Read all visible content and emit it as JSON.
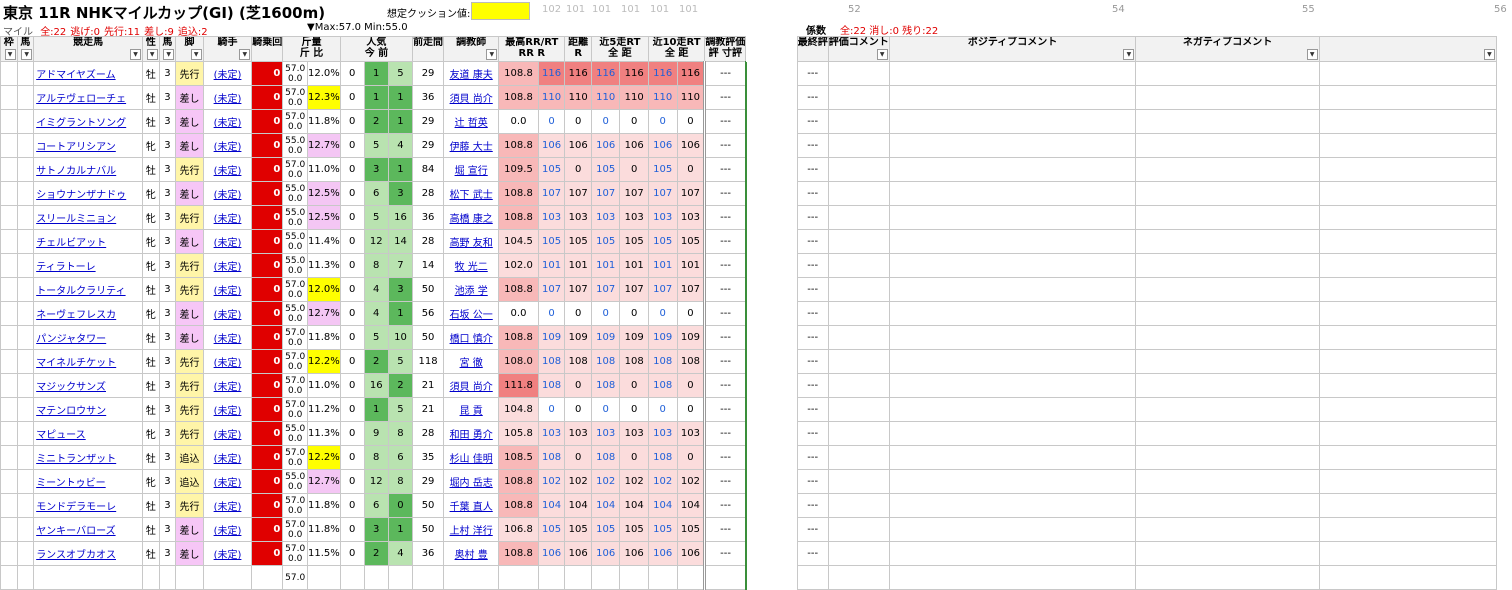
{
  "header": {
    "title": "東京 11R NHKマイルカップ(GI) (芝1600m)",
    "distance_type": "マイル",
    "counts": [
      {
        "text": "全:22",
        "color": "#e00000"
      },
      {
        "text": "逃げ:0",
        "color": "#e00000"
      },
      {
        "text": "先行:11",
        "color": "#e00000"
      },
      {
        "text": "差し:9",
        "color": "#e00000"
      },
      {
        "text": "追込:2",
        "color": "#e00000"
      }
    ],
    "cushion_label": "想定クッション値:",
    "cushion_value": "",
    "maxmin": "▼Max:57.0  Min:55.0",
    "keisu": "係数",
    "summary": "全:22  消し:0  残り:22",
    "col_numbers": [
      "102",
      "101",
      "101",
      "101",
      "101",
      "101"
    ],
    "right_numbers": [
      "52",
      "54",
      "55",
      "56"
    ]
  },
  "columns": {
    "waku": "枠",
    "uma": "馬",
    "name": "競走馬",
    "sex": "性",
    "age": "馬",
    "style": "脚",
    "jockey": "騎手",
    "kiyo": "騎乗回",
    "kinryo": "斤量",
    "kinryo_sub1": "斤",
    "kinryo_sub2": "比",
    "pop": "人気",
    "pop_sub1": "今",
    "pop_sub2": "前",
    "zensou": "前走間",
    "trainer": "調教師",
    "maxrr": "最高RR/RT",
    "maxrr_sub1": "RR",
    "maxrr_sub2": "R",
    "dist": "距離",
    "dist_sub": "R",
    "k5": "近5走RT",
    "k5_sub1": "全",
    "k5_sub2": "距",
    "k10": "近10走RT",
    "k10_sub1": "全",
    "k10_sub2": "距",
    "chokyo": "調教評価",
    "chokyo_sub1": "評",
    "chokyo_sub2": "寸評",
    "final": "最終評",
    "eval_comment": "評価コメント",
    "positive": "ポジティブコメント",
    "negative": "ネガティブコメント"
  },
  "rows": [
    {
      "name": "アドマイヤズーム",
      "sex": "牡",
      "age": "3",
      "style": "先行",
      "jockey": "(未定)",
      "kiyo": "0",
      "kin1": "57.0",
      "kin2": "0.0",
      "ratio": "12.0%",
      "ratio_c": "",
      "pop1": "0",
      "pop2": "1",
      "pop3": "5",
      "zensou": "29",
      "trainer": "友道 康夫",
      "rr": "108.8",
      "r1": "116",
      "dist": "116",
      "k5a": "116",
      "k5b": "116",
      "k10a": "116",
      "k10b": "116",
      "chokyo": "---",
      "final": "---",
      "rrc": "rr-high",
      "rc": "rr-max"
    },
    {
      "name": "アルテヴェローチェ",
      "sex": "牡",
      "age": "3",
      "style": "差し",
      "jockey": "(未定)",
      "kiyo": "0",
      "kin1": "57.0",
      "kin2": "0.0",
      "ratio": "12.3%",
      "ratio_c": "ratio-yellow",
      "pop1": "0",
      "pop2": "1",
      "pop3": "1",
      "zensou": "36",
      "trainer": "須貝 尚介",
      "rr": "108.8",
      "r1": "110",
      "dist": "110",
      "k5a": "110",
      "k5b": "110",
      "k10a": "110",
      "k10b": "110",
      "chokyo": "---",
      "final": "---",
      "rrc": "rr-high",
      "rc": "rr-high"
    },
    {
      "name": "イミグラントソング",
      "sex": "牡",
      "age": "3",
      "style": "差し",
      "jockey": "(未定)",
      "kiyo": "0",
      "kin1": "57.0",
      "kin2": "0.0",
      "ratio": "11.8%",
      "ratio_c": "",
      "pop1": "0",
      "pop2": "2",
      "pop3": "1",
      "zensou": "29",
      "trainer": "辻 哲英",
      "rr": "0.0",
      "r1": "0",
      "dist": "0",
      "k5a": "0",
      "k5b": "0",
      "k10a": "0",
      "k10b": "0",
      "chokyo": "---",
      "final": "---",
      "rrc": "rr-low",
      "rc": "rr-low"
    },
    {
      "name": "コートアリシアン",
      "sex": "牝",
      "age": "3",
      "style": "差し",
      "jockey": "(未定)",
      "kiyo": "0",
      "kin1": "55.0",
      "kin2": "0.0",
      "ratio": "12.7%",
      "ratio_c": "ratio-pink",
      "pop1": "0",
      "pop2": "5",
      "pop3": "4",
      "zensou": "29",
      "trainer": "伊藤 大士",
      "rr": "108.8",
      "r1": "106",
      "dist": "106",
      "k5a": "106",
      "k5b": "106",
      "k10a": "106",
      "k10b": "106",
      "chokyo": "---",
      "final": "---",
      "rrc": "rr-high",
      "rc": "rr-mid"
    },
    {
      "name": "サトノカルナバル",
      "sex": "牡",
      "age": "3",
      "style": "先行",
      "jockey": "(未定)",
      "kiyo": "0",
      "kin1": "57.0",
      "kin2": "0.0",
      "ratio": "11.0%",
      "ratio_c": "",
      "pop1": "0",
      "pop2": "3",
      "pop3": "1",
      "zensou": "84",
      "trainer": "堀 宣行",
      "rr": "109.5",
      "r1": "105",
      "dist": "0",
      "k5a": "105",
      "k5b": "0",
      "k10a": "105",
      "k10b": "0",
      "chokyo": "---",
      "final": "---",
      "rrc": "rr-high",
      "rc": "rr-mid"
    },
    {
      "name": "ショウナンザナドゥ",
      "sex": "牝",
      "age": "3",
      "style": "差し",
      "jockey": "(未定)",
      "kiyo": "0",
      "kin1": "55.0",
      "kin2": "0.0",
      "ratio": "12.5%",
      "ratio_c": "ratio-pink",
      "pop1": "0",
      "pop2": "6",
      "pop3": "3",
      "zensou": "28",
      "trainer": "松下 武士",
      "rr": "108.8",
      "r1": "107",
      "dist": "107",
      "k5a": "107",
      "k5b": "107",
      "k10a": "107",
      "k10b": "107",
      "chokyo": "---",
      "final": "---",
      "rrc": "rr-high",
      "rc": "rr-mid"
    },
    {
      "name": "スリールミニョン",
      "sex": "牝",
      "age": "3",
      "style": "先行",
      "jockey": "(未定)",
      "kiyo": "0",
      "kin1": "55.0",
      "kin2": "0.0",
      "ratio": "12.5%",
      "ratio_c": "ratio-pink",
      "pop1": "0",
      "pop2": "5",
      "pop3": "16",
      "zensou": "36",
      "trainer": "高橋 康之",
      "rr": "108.8",
      "r1": "103",
      "dist": "103",
      "k5a": "103",
      "k5b": "103",
      "k10a": "103",
      "k10b": "103",
      "chokyo": "---",
      "final": "---",
      "rrc": "rr-high",
      "rc": "rr-mid"
    },
    {
      "name": "チェルビアット",
      "sex": "牝",
      "age": "3",
      "style": "差し",
      "jockey": "(未定)",
      "kiyo": "0",
      "kin1": "55.0",
      "kin2": "0.0",
      "ratio": "11.4%",
      "ratio_c": "",
      "pop1": "0",
      "pop2": "12",
      "pop3": "14",
      "zensou": "28",
      "trainer": "高野 友和",
      "rr": "104.5",
      "r1": "105",
      "dist": "105",
      "k5a": "105",
      "k5b": "105",
      "k10a": "105",
      "k10b": "105",
      "chokyo": "---",
      "final": "---",
      "rrc": "rr-mid",
      "rc": "rr-mid"
    },
    {
      "name": "ティラトーレ",
      "sex": "牝",
      "age": "3",
      "style": "先行",
      "jockey": "(未定)",
      "kiyo": "0",
      "kin1": "55.0",
      "kin2": "0.0",
      "ratio": "11.3%",
      "ratio_c": "",
      "pop1": "0",
      "pop2": "8",
      "pop3": "7",
      "zensou": "14",
      "trainer": "牧 光二",
      "rr": "102.0",
      "r1": "101",
      "dist": "101",
      "k5a": "101",
      "k5b": "101",
      "k10a": "101",
      "k10b": "101",
      "chokyo": "---",
      "final": "---",
      "rrc": "rr-mid",
      "rc": "rr-mid"
    },
    {
      "name": "トータルクラリティ",
      "sex": "牡",
      "age": "3",
      "style": "先行",
      "jockey": "(未定)",
      "kiyo": "0",
      "kin1": "57.0",
      "kin2": "0.0",
      "ratio": "12.0%",
      "ratio_c": "ratio-yellow",
      "pop1": "0",
      "pop2": "4",
      "pop3": "3",
      "zensou": "50",
      "trainer": "池添 学",
      "rr": "108.8",
      "r1": "107",
      "dist": "107",
      "k5a": "107",
      "k5b": "107",
      "k10a": "107",
      "k10b": "107",
      "chokyo": "---",
      "final": "---",
      "rrc": "rr-high",
      "rc": "rr-mid"
    },
    {
      "name": "ネーヴェフレスカ",
      "sex": "牝",
      "age": "3",
      "style": "差し",
      "jockey": "(未定)",
      "kiyo": "0",
      "kin1": "55.0",
      "kin2": "0.0",
      "ratio": "12.7%",
      "ratio_c": "ratio-pink",
      "pop1": "0",
      "pop2": "4",
      "pop3": "1",
      "zensou": "56",
      "trainer": "石坂 公一",
      "rr": "0.0",
      "r1": "0",
      "dist": "0",
      "k5a": "0",
      "k5b": "0",
      "k10a": "0",
      "k10b": "0",
      "chokyo": "---",
      "final": "---",
      "rrc": "rr-low",
      "rc": "rr-low"
    },
    {
      "name": "パンジャタワー",
      "sex": "牡",
      "age": "3",
      "style": "差し",
      "jockey": "(未定)",
      "kiyo": "0",
      "kin1": "57.0",
      "kin2": "0.0",
      "ratio": "11.8%",
      "ratio_c": "",
      "pop1": "0",
      "pop2": "5",
      "pop3": "10",
      "zensou": "50",
      "trainer": "橋口 慎介",
      "rr": "108.8",
      "r1": "109",
      "dist": "109",
      "k5a": "109",
      "k5b": "109",
      "k10a": "109",
      "k10b": "109",
      "chokyo": "---",
      "final": "---",
      "rrc": "rr-high",
      "rc": "rr-mid"
    },
    {
      "name": "マイネルチケット",
      "sex": "牡",
      "age": "3",
      "style": "先行",
      "jockey": "(未定)",
      "kiyo": "0",
      "kin1": "57.0",
      "kin2": "0.0",
      "ratio": "12.2%",
      "ratio_c": "ratio-yellow",
      "pop1": "0",
      "pop2": "2",
      "pop3": "5",
      "zensou": "118",
      "trainer": "宮 徹",
      "rr": "108.0",
      "r1": "108",
      "dist": "108",
      "k5a": "108",
      "k5b": "108",
      "k10a": "108",
      "k10b": "108",
      "chokyo": "---",
      "final": "---",
      "rrc": "rr-high",
      "rc": "rr-mid"
    },
    {
      "name": "マジックサンズ",
      "sex": "牡",
      "age": "3",
      "style": "先行",
      "jockey": "(未定)",
      "kiyo": "0",
      "kin1": "57.0",
      "kin2": "0.0",
      "ratio": "11.0%",
      "ratio_c": "",
      "pop1": "0",
      "pop2": "16",
      "pop3": "2",
      "zensou": "21",
      "trainer": "須貝 尚介",
      "rr": "111.8",
      "r1": "108",
      "dist": "0",
      "k5a": "108",
      "k5b": "0",
      "k10a": "108",
      "k10b": "0",
      "chokyo": "---",
      "final": "---",
      "rrc": "rr-max",
      "rc": "rr-mid"
    },
    {
      "name": "マテンロウサン",
      "sex": "牡",
      "age": "3",
      "style": "先行",
      "jockey": "(未定)",
      "kiyo": "0",
      "kin1": "57.0",
      "kin2": "0.0",
      "ratio": "11.2%",
      "ratio_c": "",
      "pop1": "0",
      "pop2": "1",
      "pop3": "5",
      "zensou": "21",
      "trainer": "昆 貢",
      "rr": "104.8",
      "r1": "0",
      "dist": "0",
      "k5a": "0",
      "k5b": "0",
      "k10a": "0",
      "k10b": "0",
      "chokyo": "---",
      "final": "---",
      "rrc": "rr-mid",
      "rc": "rr-low"
    },
    {
      "name": "マピュース",
      "sex": "牝",
      "age": "3",
      "style": "先行",
      "jockey": "(未定)",
      "kiyo": "0",
      "kin1": "55.0",
      "kin2": "0.0",
      "ratio": "11.3%",
      "ratio_c": "",
      "pop1": "0",
      "pop2": "9",
      "pop3": "8",
      "zensou": "28",
      "trainer": "和田 勇介",
      "rr": "105.8",
      "r1": "103",
      "dist": "103",
      "k5a": "103",
      "k5b": "103",
      "k10a": "103",
      "k10b": "103",
      "chokyo": "---",
      "final": "---",
      "rrc": "rr-mid",
      "rc": "rr-mid"
    },
    {
      "name": "ミニトランザット",
      "sex": "牡",
      "age": "3",
      "style": "追込",
      "jockey": "(未定)",
      "kiyo": "0",
      "kin1": "57.0",
      "kin2": "0.0",
      "ratio": "12.2%",
      "ratio_c": "ratio-yellow",
      "pop1": "0",
      "pop2": "8",
      "pop3": "6",
      "zensou": "35",
      "trainer": "杉山 佳明",
      "rr": "108.5",
      "r1": "108",
      "dist": "0",
      "k5a": "108",
      "k5b": "0",
      "k10a": "108",
      "k10b": "0",
      "chokyo": "---",
      "final": "---",
      "rrc": "rr-high",
      "rc": "rr-mid"
    },
    {
      "name": "ミーントゥビー",
      "sex": "牝",
      "age": "3",
      "style": "追込",
      "jockey": "(未定)",
      "kiyo": "0",
      "kin1": "55.0",
      "kin2": "0.0",
      "ratio": "12.7%",
      "ratio_c": "ratio-pink",
      "pop1": "0",
      "pop2": "12",
      "pop3": "8",
      "zensou": "29",
      "trainer": "堀内 岳志",
      "rr": "108.8",
      "r1": "102",
      "dist": "102",
      "k5a": "102",
      "k5b": "102",
      "k10a": "102",
      "k10b": "102",
      "chokyo": "---",
      "final": "---",
      "rrc": "rr-high",
      "rc": "rr-mid"
    },
    {
      "name": "モンドデラモーレ",
      "sex": "牡",
      "age": "3",
      "style": "先行",
      "jockey": "(未定)",
      "kiyo": "0",
      "kin1": "57.0",
      "kin2": "0.0",
      "ratio": "11.8%",
      "ratio_c": "",
      "pop1": "0",
      "pop2": "6",
      "pop3": "0",
      "zensou": "50",
      "trainer": "千葉 直人",
      "rr": "108.8",
      "r1": "104",
      "dist": "104",
      "k5a": "104",
      "k5b": "104",
      "k10a": "104",
      "k10b": "104",
      "chokyo": "---",
      "final": "---",
      "rrc": "rr-high",
      "rc": "rr-mid"
    },
    {
      "name": "ヤンキーバローズ",
      "sex": "牡",
      "age": "3",
      "style": "差し",
      "jockey": "(未定)",
      "kiyo": "0",
      "kin1": "57.0",
      "kin2": "0.0",
      "ratio": "11.8%",
      "ratio_c": "",
      "pop1": "0",
      "pop2": "3",
      "pop3": "1",
      "zensou": "50",
      "trainer": "上村 洋行",
      "rr": "106.8",
      "r1": "105",
      "dist": "105",
      "k5a": "105",
      "k5b": "105",
      "k10a": "105",
      "k10b": "105",
      "chokyo": "---",
      "final": "---",
      "rrc": "rr-mid",
      "rc": "rr-mid"
    },
    {
      "name": "ランスオブカオス",
      "sex": "牡",
      "age": "3",
      "style": "差し",
      "jockey": "(未定)",
      "kiyo": "0",
      "kin1": "57.0",
      "kin2": "0.0",
      "ratio": "11.5%",
      "ratio_c": "",
      "pop1": "0",
      "pop2": "2",
      "pop3": "4",
      "zensou": "36",
      "trainer": "奥村 豊",
      "rr": "108.8",
      "r1": "106",
      "dist": "106",
      "k5a": "106",
      "k5b": "106",
      "k10a": "106",
      "k10b": "106",
      "chokyo": "---",
      "final": "---",
      "rrc": "rr-high",
      "rc": "rr-mid"
    },
    {
      "name": "",
      "sex": "",
      "age": "",
      "style": "",
      "jockey": "",
      "kiyo": "",
      "kin1": "57.0",
      "kin2": "",
      "ratio": "",
      "ratio_c": "",
      "pop1": "",
      "pop2": "",
      "pop3": "",
      "zensou": "",
      "trainer": "",
      "rr": "",
      "r1": "",
      "dist": "",
      "k5a": "",
      "k5b": "",
      "k10a": "",
      "k10b": "",
      "chokyo": "",
      "final": "",
      "rrc": "rr-low",
      "rc": "rr-low"
    }
  ]
}
